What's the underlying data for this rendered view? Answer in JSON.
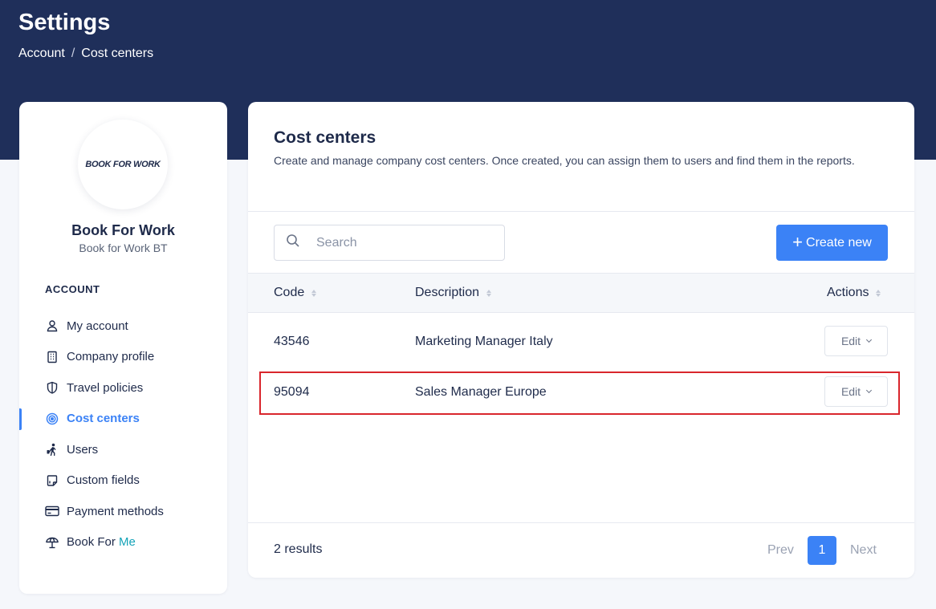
{
  "header": {
    "title": "Settings",
    "breadcrumb": [
      "Account",
      "Cost centers"
    ],
    "breadcrumb_separator": "/"
  },
  "sidebar": {
    "logo_text": "BOOK FOR WORK",
    "company_name": "Book For Work",
    "company_subtitle": "Book for Work BT",
    "section_label": "ACCOUNT",
    "items": [
      {
        "label": "My account",
        "icon": "user-icon"
      },
      {
        "label": "Company profile",
        "icon": "building-icon"
      },
      {
        "label": "Travel policies",
        "icon": "shield-icon"
      },
      {
        "label": "Cost centers",
        "icon": "target-icon",
        "active": true
      },
      {
        "label": "Users",
        "icon": "traveler-icon"
      },
      {
        "label": "Custom fields",
        "icon": "custom-field-icon"
      },
      {
        "label": "Payment methods",
        "icon": "credit-card-icon"
      },
      {
        "label": "Book For ",
        "label_accent": "Me",
        "icon": "beach-umbrella-icon"
      }
    ]
  },
  "main": {
    "title": "Cost centers",
    "description": "Create and manage company cost centers. Once created, you can assign them to users and find them in the reports.",
    "search": {
      "placeholder": "Search",
      "value": ""
    },
    "create_button": "Create new",
    "table": {
      "columns": [
        "Code",
        "Description",
        "Actions"
      ],
      "rows": [
        {
          "code": "43546",
          "description": "Marketing Manager Italy",
          "action": "Edit"
        },
        {
          "code": "95094",
          "description": "Sales Manager Europe",
          "action": "Edit",
          "highlighted": true
        }
      ]
    },
    "footer": {
      "results": "2 results",
      "prev": "Prev",
      "page": "1",
      "next": "Next"
    }
  },
  "colors": {
    "header_bg": "#1f2f5a",
    "accent": "#3b82f6",
    "accent_teal": "#14a3b8",
    "highlight": "#d9262c"
  }
}
